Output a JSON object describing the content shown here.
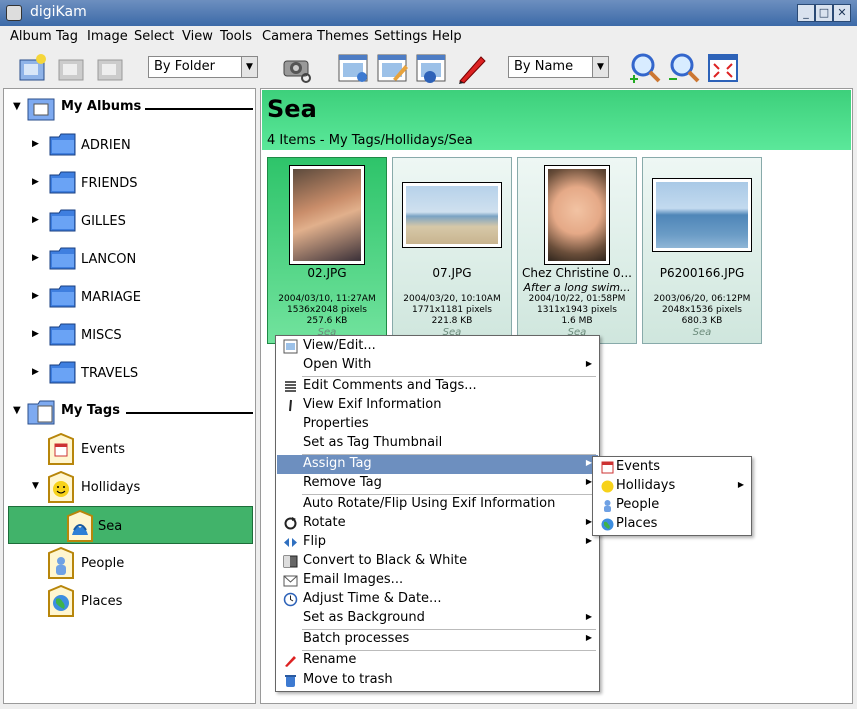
{
  "window": {
    "title": "digiKam"
  },
  "menubar": [
    "Album",
    "Tag",
    "Image",
    "Select",
    "View",
    "Tools",
    "Camera",
    "Themes",
    "Settings",
    "Help"
  ],
  "toolbar": {
    "group_by": "By Folder",
    "sort_by": "By Name"
  },
  "sidebar": {
    "albums_title": "My Albums",
    "albums": [
      "ADRIEN",
      "FRIENDS",
      "GILLES",
      "LANCON",
      "MARIAGE",
      "MISCS",
      "TRAVELS"
    ],
    "tags_title": "My Tags",
    "tags": [
      "Events",
      "Hollidays",
      "Sea",
      "People",
      "Places"
    ]
  },
  "banner": {
    "title": "Sea",
    "subtitle": "4 Items - My Tags/Hollidays/Sea"
  },
  "thumbs": [
    {
      "name": "02.JPG",
      "comment": "",
      "date": "2004/03/10, 11:27AM",
      "dims": "1536x2048 pixels",
      "size": "257.6 KB",
      "tags": "Sea"
    },
    {
      "name": "07.JPG",
      "comment": "",
      "date": "2004/03/20, 10:10AM",
      "dims": "1771x1181 pixels",
      "size": "221.8 KB",
      "tags": "Sea"
    },
    {
      "name": "Chez Christine 0...",
      "comment": "After a long swim...",
      "date": "2004/10/22, 01:58PM",
      "dims": "1311x1943 pixels",
      "size": "1.6 MB",
      "tags": "Sea"
    },
    {
      "name": "P6200166.JPG",
      "comment": "",
      "date": "2003/06/20, 06:12PM",
      "dims": "2048x1536 pixels",
      "size": "680.3 KB",
      "tags": "Sea"
    }
  ],
  "context_menu": {
    "items": [
      "View/Edit...",
      "Open With",
      "Edit Comments and Tags...",
      "View Exif Information",
      "Properties",
      "Set as Tag Thumbnail",
      "Assign Tag",
      "Remove Tag",
      "Auto Rotate/Flip Using Exif Information",
      "Rotate",
      "Flip",
      "Convert to Black & White",
      "Email Images...",
      "Adjust Time & Date...",
      "Set as Background",
      "Batch processes",
      "Rename",
      "Move to trash"
    ],
    "submenu": [
      "Events",
      "Hollidays",
      "People",
      "Places"
    ]
  }
}
